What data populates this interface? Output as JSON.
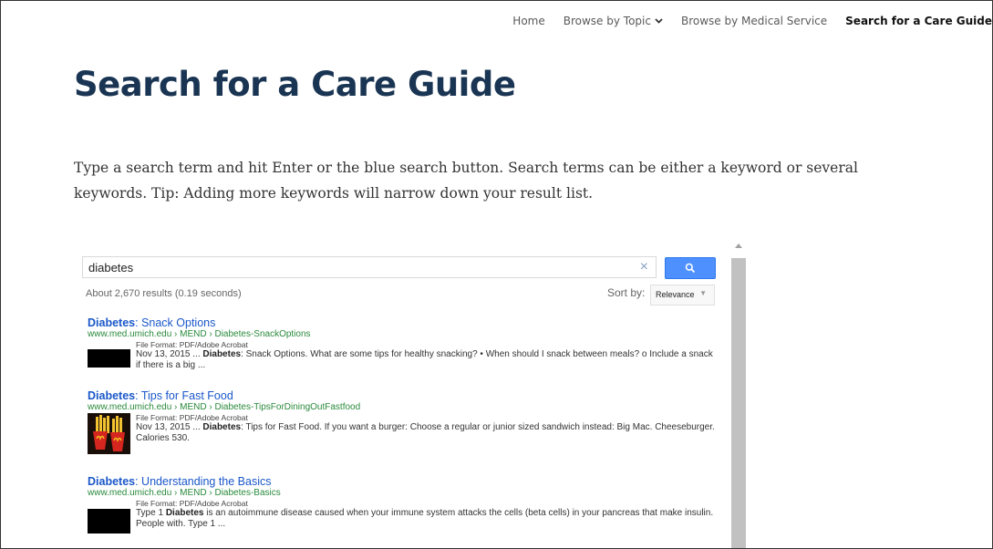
{
  "nav": {
    "items": [
      {
        "label": "Home"
      },
      {
        "label": "Browse by Topic"
      },
      {
        "label": "Browse by Medical Service"
      },
      {
        "label": "Search for a Care Guide"
      }
    ]
  },
  "page": {
    "title": "Search for a Care Guide",
    "intro": "Type a search term and hit Enter or the blue search button.  Search terms can be either a keyword or several keywords.  Tip: Adding more keywords will narrow down your result list."
  },
  "search": {
    "value": "diabetes",
    "clear_icon": "×",
    "result_info": "About 2,670 results (0.19 seconds)",
    "sort_label": "Sort by:",
    "sort_value": "Relevance",
    "sort_arrow": "▼"
  },
  "results": [
    {
      "title_bold": "Diabetes",
      "title_rest": ": Snack Options",
      "url": "www.med.umich.edu › MEND › Diabetes-SnackOptions",
      "format": "File Format: PDF/Adobe Acrobat",
      "snip_pre": "Nov 13, 2015 ... ",
      "snip_bold": "Diabetes",
      "snip_post": ": Snack Options. What are some tips for healthy snacking? • When should I snack between meals? o Include a snack if there is a big ..."
    },
    {
      "title_bold": "Diabetes",
      "title_rest": ": Tips for Fast Food",
      "url": "www.med.umich.edu › MEND › Diabetes-TipsForDiningOutFastfood",
      "format": "File Format: PDF/Adobe Acrobat",
      "snip_pre": "Nov 13, 2015 ... ",
      "snip_bold": "Diabetes",
      "snip_post": ": Tips for Fast Food. If you want a burger: Choose a regular or junior sized sandwich instead: Big Mac. Cheeseburger. Calories 530."
    },
    {
      "title_bold": "Diabetes",
      "title_rest": ": Understanding the Basics",
      "url": "www.med.umich.edu › MEND › Diabetes-Basics",
      "format": "File Format: PDF/Adobe Acrobat",
      "snip_pre": "Type 1 ",
      "snip_bold": "Diabetes",
      "snip_post": " is an autoimmune disease caused when your immune system attacks the cells (beta cells) in your pancreas that make insulin. People with. Type 1 ..."
    }
  ],
  "colors": {
    "title": "#1a3553",
    "link": "#1a57c9",
    "url": "#2a8a3c",
    "search_button": "#4d90fe"
  },
  "icons": {
    "nav_chevron": "chevron-down-icon",
    "search_button": "search-icon",
    "clear": "close-icon",
    "fastfood_thumb": "fries-image"
  }
}
